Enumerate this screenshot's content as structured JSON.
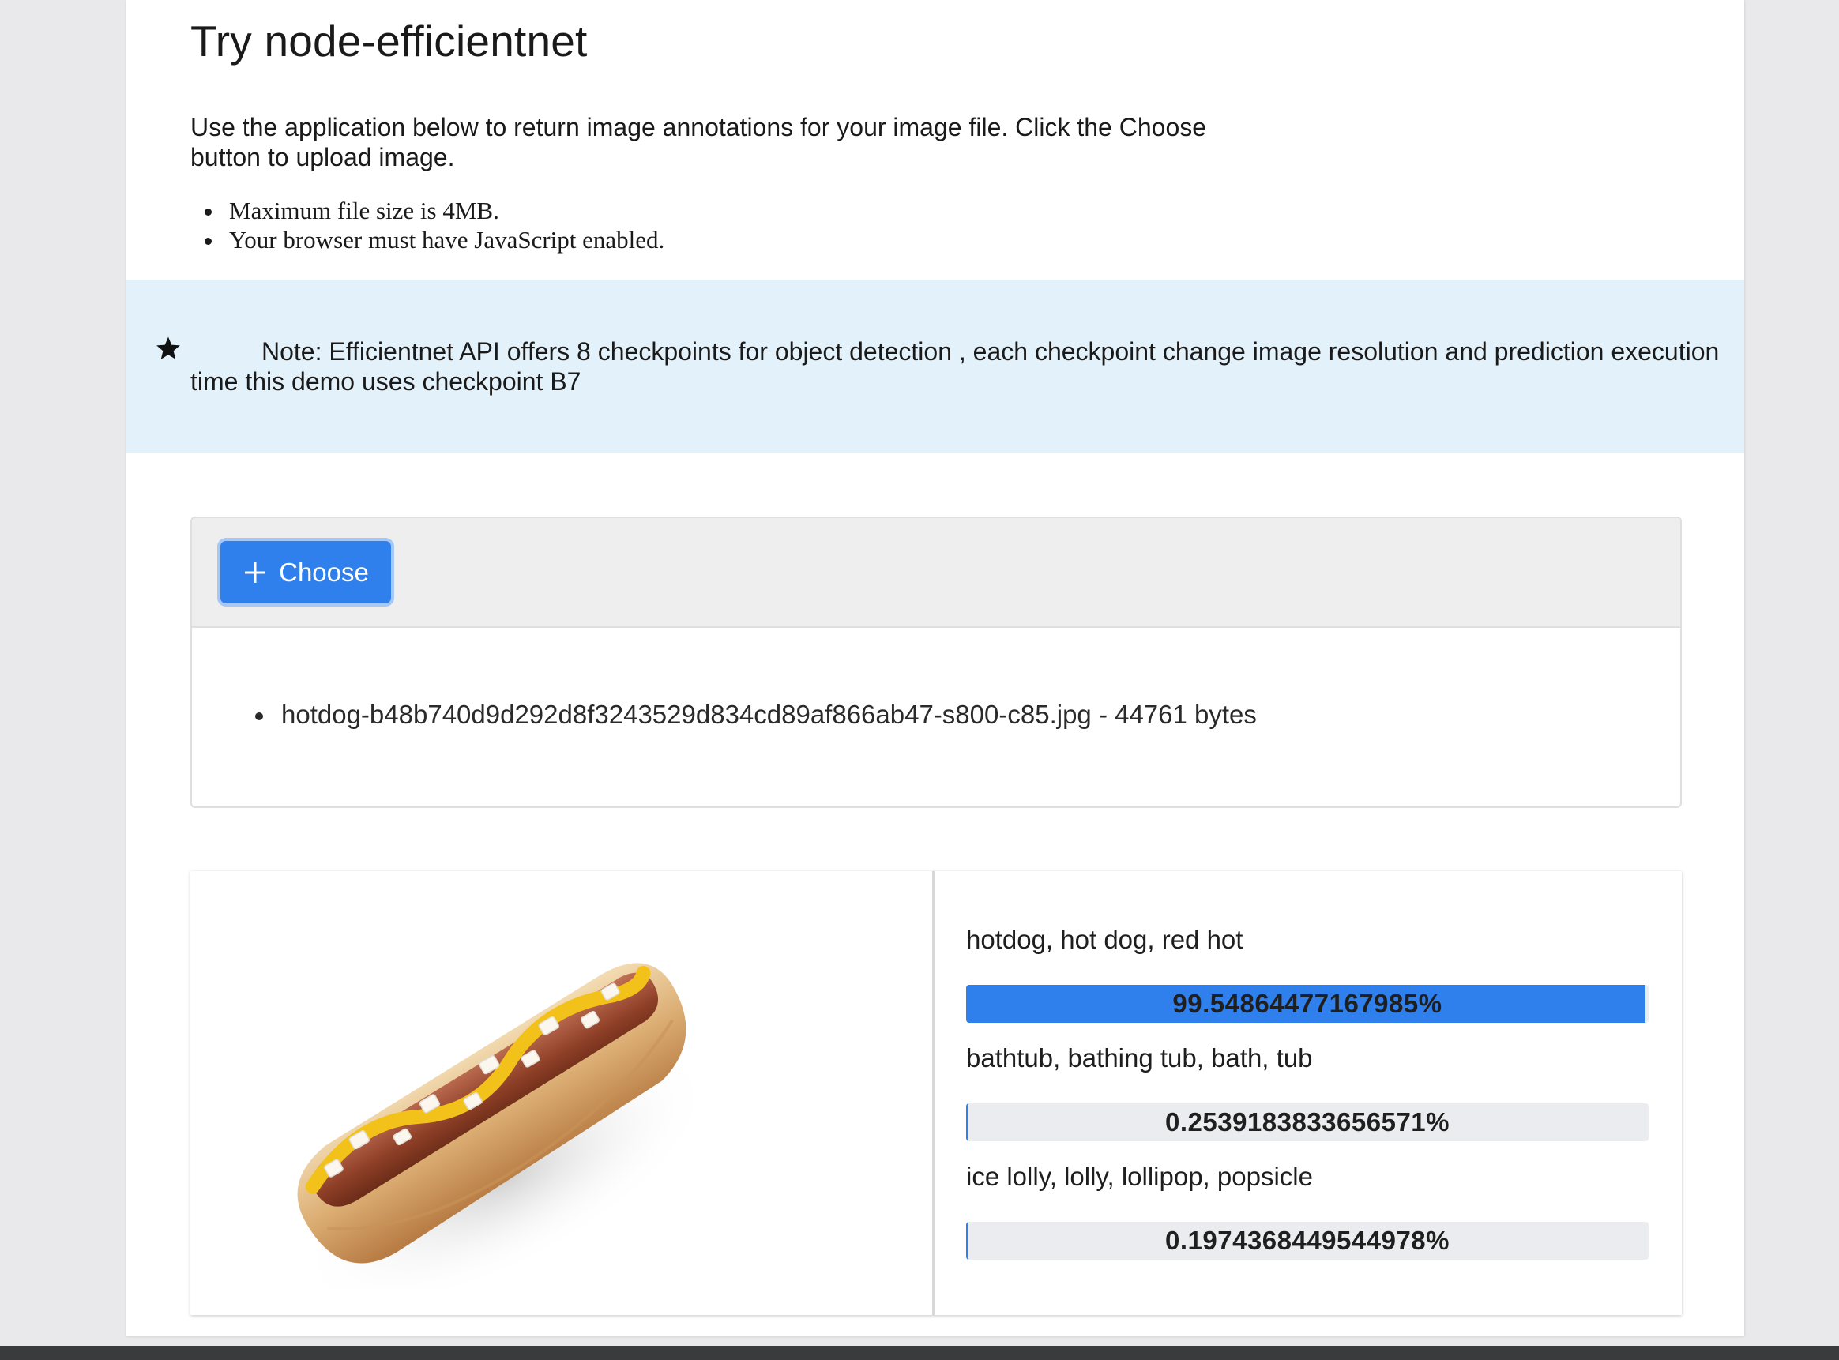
{
  "page": {
    "title": "Try node-efficientnet",
    "intro": "Use the application below to return image annotations for your image file. Click the Choose button to upload image.",
    "requirements": [
      "Maximum file size is 4MB.",
      "Your browser must have JavaScript enabled."
    ],
    "note": {
      "icon": "star-icon",
      "text": "Note: Efficientnet API offers 8 checkpoints for object detection , each checkpoint change image resolution and prediction execution time this demo uses checkpoint B7"
    }
  },
  "uploader": {
    "choose_label": "Choose",
    "choose_icon": "plus-icon",
    "files": [
      {
        "text": "hotdog-b48b740d9d292d8f3243529d834cd89af866ab47-s800-c85.jpg - 44761 bytes"
      }
    ]
  },
  "results": {
    "image_description_icon": "hotdog-image",
    "predictions": [
      {
        "label": "hotdog, hot dog, red hot",
        "value": "99.54864477167985%",
        "fraction": 0.9955
      },
      {
        "label": "bathtub, bathing tub, bath, tub",
        "value": "0.2539183833656571%",
        "fraction": 0.0025
      },
      {
        "label": "ice lolly, lolly, lollipop, popsicle",
        "value": "0.1974368449544978%",
        "fraction": 0.002
      }
    ]
  },
  "colors": {
    "accent": "#2f80ed",
    "note_background": "#e3f1fa",
    "bar_track": "#ebecef"
  }
}
